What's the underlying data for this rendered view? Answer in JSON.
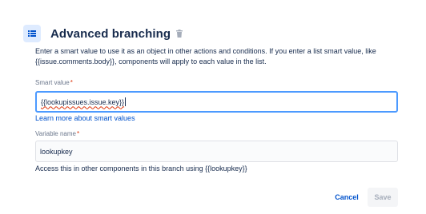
{
  "header": {
    "title": "Advanced branching",
    "icon": "branch-list-icon",
    "delete_icon": "trash-icon",
    "accent": "#0052cc"
  },
  "description": "Enter a smart value to use it as an object in other actions and conditions. If you enter a list smart value, like {{issue.comments.body}}, components will apply to each value in the list.",
  "smart_value": {
    "label": "Smart value",
    "required_mark": "*",
    "value": "{{lookupissues.issue.key}}",
    "link": "Learn more about smart values"
  },
  "variable_name": {
    "label": "Variable name",
    "required_mark": "*",
    "value": "lookupkey",
    "help": "Access this in other components in this branch using {{lookupkey}}"
  },
  "actions": {
    "cancel": "Cancel",
    "save": "Save"
  }
}
